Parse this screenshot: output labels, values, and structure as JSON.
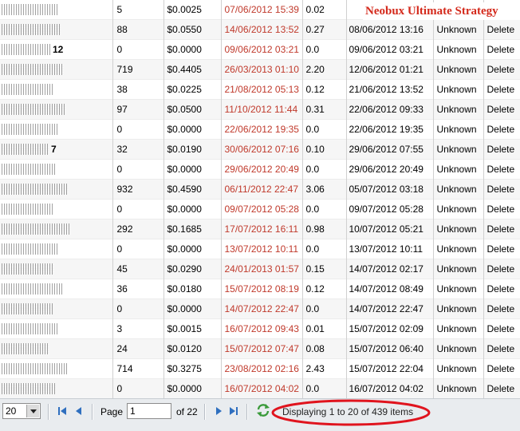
{
  "overlay_title": "Neobux Ultimate Strategy",
  "rows": [
    {
      "name_suffix": "",
      "clicks": "5",
      "earned": "$0.0025",
      "last_click": "07/06/2012 15:39",
      "avg": "0.02",
      "since": "",
      "ref": "",
      "action": ""
    },
    {
      "name_suffix": "",
      "clicks": "88",
      "earned": "$0.0550",
      "last_click": "14/06/2012 13:52",
      "avg": "0.27",
      "since": "08/06/2012 13:16",
      "ref": "Unknown",
      "action": "Delete"
    },
    {
      "name_suffix": "12",
      "clicks": "0",
      "earned": "$0.0000",
      "last_click": "09/06/2012 03:21",
      "avg": "0.0",
      "since": "09/06/2012 03:21",
      "ref": "Unknown",
      "action": "Delete"
    },
    {
      "name_suffix": "",
      "clicks": "719",
      "earned": "$0.4405",
      "last_click": "26/03/2013 01:10",
      "avg": "2.20",
      "since": "12/06/2012 01:21",
      "ref": "Unknown",
      "action": "Delete"
    },
    {
      "name_suffix": "",
      "clicks": "38",
      "earned": "$0.0225",
      "last_click": "21/08/2012 05:13",
      "avg": "0.12",
      "since": "21/06/2012 13:52",
      "ref": "Unknown",
      "action": "Delete"
    },
    {
      "name_suffix": "",
      "clicks": "97",
      "earned": "$0.0500",
      "last_click": "11/10/2012 11:44",
      "avg": "0.31",
      "since": "22/06/2012 09:33",
      "ref": "Unknown",
      "action": "Delete"
    },
    {
      "name_suffix": "",
      "clicks": "0",
      "earned": "$0.0000",
      "last_click": "22/06/2012 19:35",
      "avg": "0.0",
      "since": "22/06/2012 19:35",
      "ref": "Unknown",
      "action": "Delete"
    },
    {
      "name_suffix": "7",
      "clicks": "32",
      "earned": "$0.0190",
      "last_click": "30/06/2012 07:16",
      "avg": "0.10",
      "since": "29/06/2012 07:55",
      "ref": "Unknown",
      "action": "Delete"
    },
    {
      "name_suffix": "",
      "clicks": "0",
      "earned": "$0.0000",
      "last_click": "29/06/2012 20:49",
      "avg": "0.0",
      "since": "29/06/2012 20:49",
      "ref": "Unknown",
      "action": "Delete"
    },
    {
      "name_suffix": "",
      "clicks": "932",
      "earned": "$0.4590",
      "last_click": "06/11/2012 22:47",
      "avg": "3.06",
      "since": "05/07/2012 03:18",
      "ref": "Unknown",
      "action": "Delete"
    },
    {
      "name_suffix": "",
      "clicks": "0",
      "earned": "$0.0000",
      "last_click": "09/07/2012 05:28",
      "avg": "0.0",
      "since": "09/07/2012 05:28",
      "ref": "Unknown",
      "action": "Delete"
    },
    {
      "name_suffix": "",
      "clicks": "292",
      "earned": "$0.1685",
      "last_click": "17/07/2012 16:11",
      "avg": "0.98",
      "since": "10/07/2012 05:21",
      "ref": "Unknown",
      "action": "Delete"
    },
    {
      "name_suffix": "",
      "clicks": "0",
      "earned": "$0.0000",
      "last_click": "13/07/2012 10:11",
      "avg": "0.0",
      "since": "13/07/2012 10:11",
      "ref": "Unknown",
      "action": "Delete"
    },
    {
      "name_suffix": "",
      "clicks": "45",
      "earned": "$0.0290",
      "last_click": "24/01/2013 01:57",
      "avg": "0.15",
      "since": "14/07/2012 02:17",
      "ref": "Unknown",
      "action": "Delete"
    },
    {
      "name_suffix": "",
      "clicks": "36",
      "earned": "$0.0180",
      "last_click": "15/07/2012 08:19",
      "avg": "0.12",
      "since": "14/07/2012 08:49",
      "ref": "Unknown",
      "action": "Delete"
    },
    {
      "name_suffix": "",
      "clicks": "0",
      "earned": "$0.0000",
      "last_click": "14/07/2012 22:47",
      "avg": "0.0",
      "since": "14/07/2012 22:47",
      "ref": "Unknown",
      "action": "Delete"
    },
    {
      "name_suffix": "",
      "clicks": "3",
      "earned": "$0.0015",
      "last_click": "16/07/2012 09:43",
      "avg": "0.01",
      "since": "15/07/2012 02:09",
      "ref": "Unknown",
      "action": "Delete"
    },
    {
      "name_suffix": "",
      "clicks": "24",
      "earned": "$0.0120",
      "last_click": "15/07/2012 07:47",
      "avg": "0.08",
      "since": "15/07/2012 06:40",
      "ref": "Unknown",
      "action": "Delete"
    },
    {
      "name_suffix": "",
      "clicks": "714",
      "earned": "$0.3275",
      "last_click": "23/08/2012 02:16",
      "avg": "2.43",
      "since": "15/07/2012 22:04",
      "ref": "Unknown",
      "action": "Delete"
    },
    {
      "name_suffix": "",
      "clicks": "0",
      "earned": "$0.0000",
      "last_click": "16/07/2012 04:02",
      "avg": "0.0",
      "since": "16/07/2012 04:02",
      "ref": "Unknown",
      "action": "Delete"
    }
  ],
  "pager": {
    "per_page_value": "20",
    "page_label": "Page",
    "current_page": "1",
    "of_total": "of 22",
    "status": "Displaying 1 to 20 of 439 items"
  },
  "colors": {
    "overlay_title": "#d42a1c",
    "last_click_text": "#c0392b",
    "highlight_ring": "#e0141e",
    "nav_icon": "#2f6fbf",
    "refresh_icon": "#3a9a3a"
  },
  "icons": {
    "first": "first-page-icon",
    "prev": "prev-page-icon",
    "next": "next-page-icon",
    "last": "last-page-icon",
    "refresh": "refresh-icon",
    "dropdown": "chevron-down-icon"
  }
}
